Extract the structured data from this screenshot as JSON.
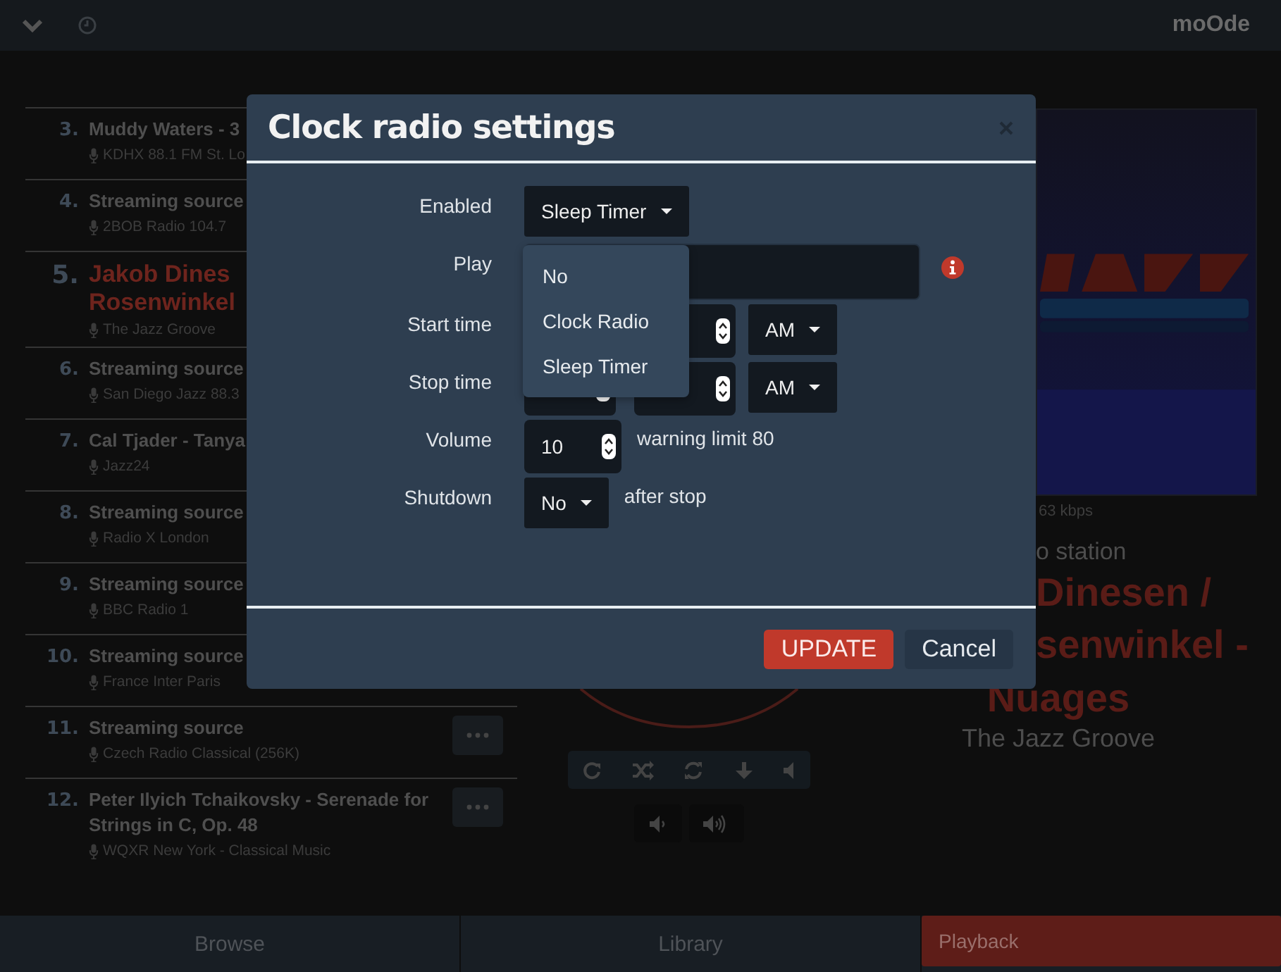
{
  "top_bar": {
    "brand": "moOde"
  },
  "playlist": [
    {
      "number": "3.",
      "title": "Muddy Waters - 3",
      "station": "KDHX 88.1 FM St. Lo",
      "current": false
    },
    {
      "number": "4.",
      "title": "Streaming source",
      "station": "2BOB Radio 104.7",
      "current": false
    },
    {
      "number": "5.",
      "title": "Jakob Dines Rosenwinkel",
      "station": "The Jazz Groove",
      "current": true
    },
    {
      "number": "6.",
      "title": "Streaming source",
      "station": "San Diego Jazz 88.3",
      "current": false
    },
    {
      "number": "7.",
      "title": "Cal Tjader - Tanya",
      "station": "Jazz24",
      "current": false
    },
    {
      "number": "8.",
      "title": "Streaming source",
      "station": "Radio X London",
      "current": false
    },
    {
      "number": "9.",
      "title": "Streaming source",
      "station": "BBC Radio 1",
      "current": false
    },
    {
      "number": "10.",
      "title": "Streaming source",
      "station": "France Inter Paris",
      "current": false
    },
    {
      "number": "11.",
      "title": "Streaming source",
      "station": "Czech Radio Classical (256K)",
      "current": false,
      "menu": true
    },
    {
      "number": "12.",
      "title": "Peter Ilyich Tchaikovsky - Serenade for Strings in C, Op. 48",
      "station": "WQXR New York - Classical Music",
      "current": false,
      "menu": true
    }
  ],
  "now_playing": {
    "bitrate": "63 kbps",
    "source": "o station",
    "title_lines": [
      "Dinesen /",
      "senwinkel -",
      "Nuages"
    ],
    "station": "The Jazz Groove"
  },
  "tabs": [
    {
      "label": "Browse",
      "selected": false
    },
    {
      "label": "Library",
      "selected": false
    },
    {
      "label": "Playback",
      "selected": true
    }
  ],
  "dialog": {
    "title": "Clock radio settings",
    "form": [
      {
        "label": "Enabled",
        "kind": "select",
        "value": "Sleep Timer",
        "open": true,
        "options": [
          "No",
          "Clock Radio",
          "Sleep Timer"
        ]
      },
      {
        "label": "Play",
        "kind": "text",
        "info": true
      },
      {
        "label": "Start time",
        "kind": "time",
        "period": "AM"
      },
      {
        "label": "Stop time",
        "kind": "time",
        "period": "AM"
      },
      {
        "label": "Volume",
        "kind": "number",
        "value": "10",
        "note": "warning limit 80"
      },
      {
        "label": "Shutdown",
        "kind": "select",
        "value": "No",
        "note": "after stop"
      }
    ],
    "buttons": [
      {
        "label": "UPDATE",
        "kind": "primary"
      },
      {
        "label": "Cancel",
        "kind": "secondary"
      }
    ]
  }
}
